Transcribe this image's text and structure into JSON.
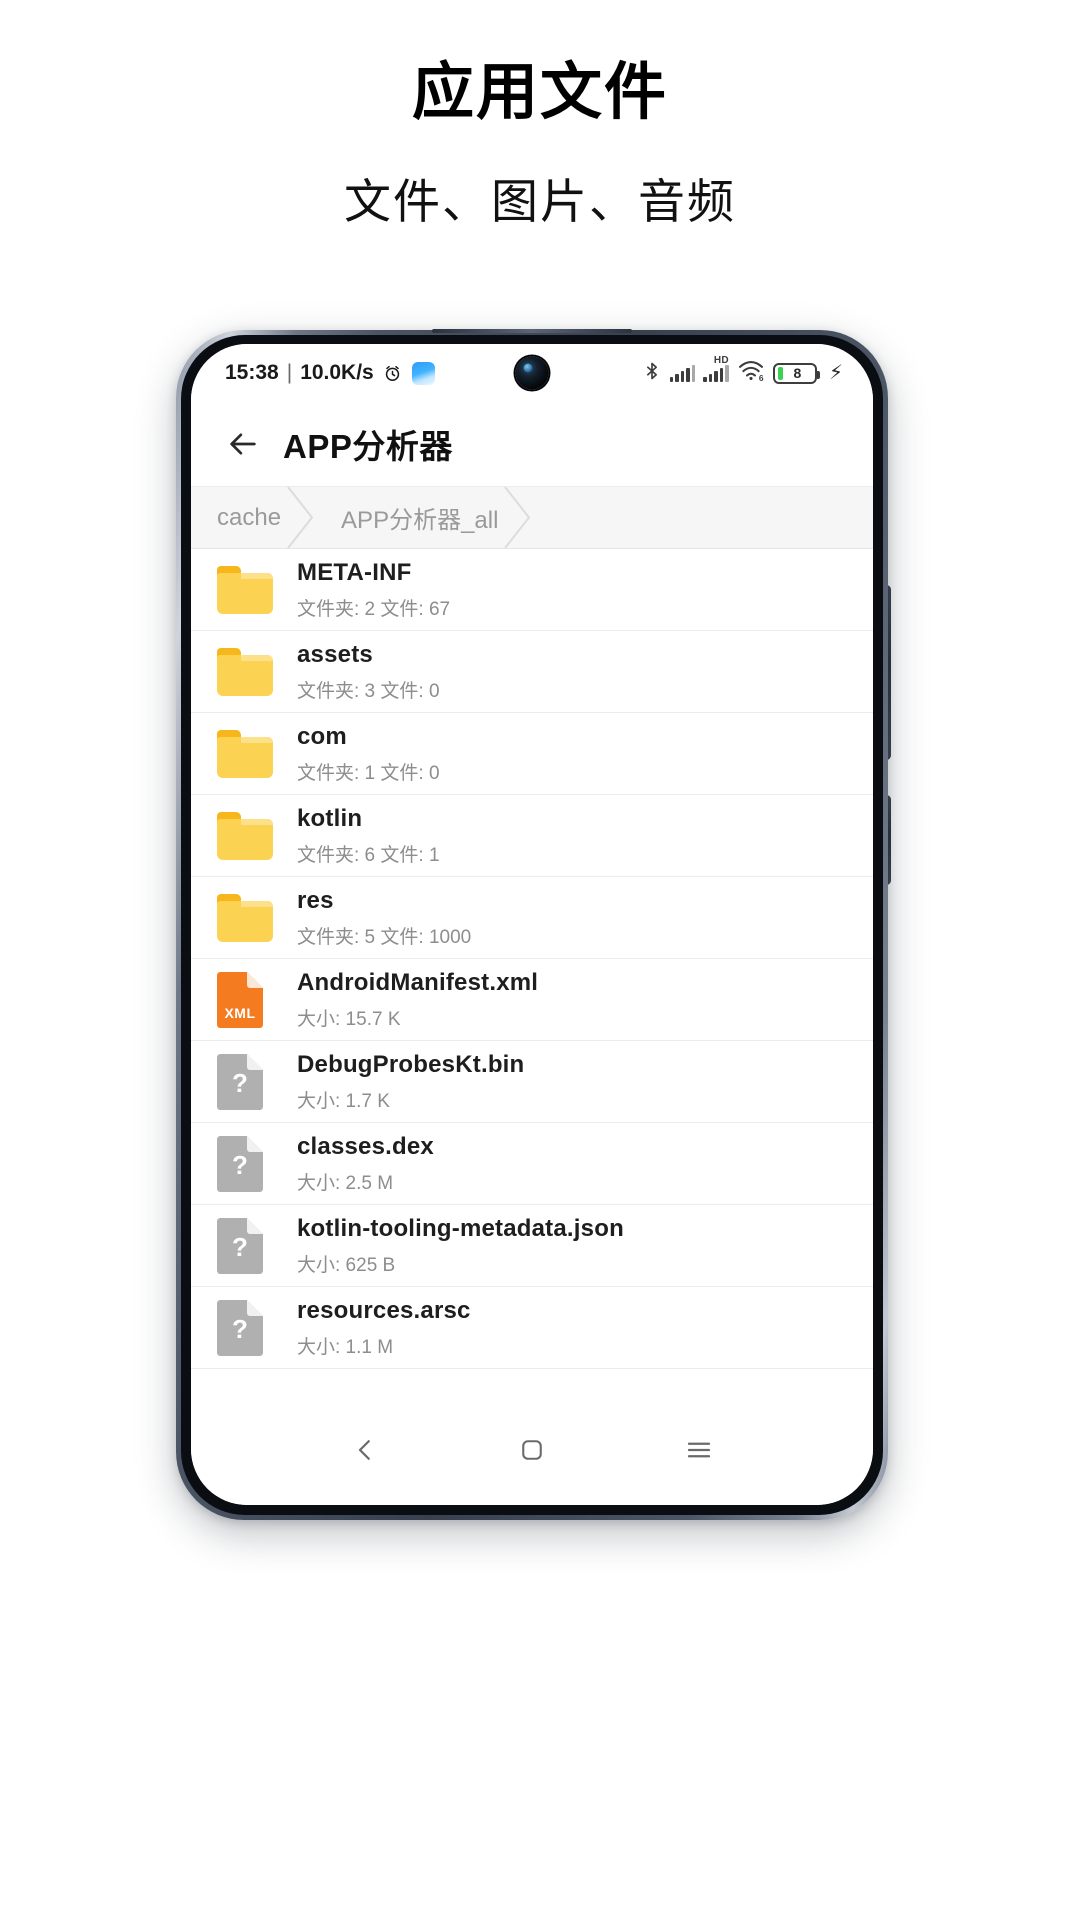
{
  "promo": {
    "title": "应用文件",
    "subtitle": "文件、图片、音频"
  },
  "statusbar": {
    "time": "15:38",
    "divider": "|",
    "netspeed": "10.0K/s",
    "alarm_icon": "alarm-clock-icon",
    "weather_icon": "weather-app-icon",
    "bluetooth_icon": "bluetooth-icon",
    "signal_icon": "signal-bars-icon",
    "hd_label": "HD",
    "wifi_icon": "wifi-6-icon",
    "wifi_label": "6",
    "battery_level": "8",
    "charging_icon": "charging-bolt-icon"
  },
  "appbar": {
    "back_icon": "back-arrow-icon",
    "title": "APP分析器"
  },
  "breadcrumb": {
    "items": [
      {
        "label": "cache"
      },
      {
        "label": "APP分析器_all"
      }
    ]
  },
  "list": {
    "rows": [
      {
        "name": "META-INF",
        "sub": "文件夹: 2 文件: 67",
        "icon": "folder-icon",
        "kind": "folder"
      },
      {
        "name": "assets",
        "sub": "文件夹: 3 文件: 0",
        "icon": "folder-icon",
        "kind": "folder"
      },
      {
        "name": "com",
        "sub": "文件夹: 1 文件: 0",
        "icon": "folder-icon",
        "kind": "folder"
      },
      {
        "name": "kotlin",
        "sub": "文件夹: 6 文件: 1",
        "icon": "folder-icon",
        "kind": "folder"
      },
      {
        "name": "res",
        "sub": "文件夹: 5 文件: 1000",
        "icon": "folder-icon",
        "kind": "folder"
      },
      {
        "name": "AndroidManifest.xml",
        "sub": "大小: 15.7 K",
        "icon": "xml-file-icon",
        "kind": "xml",
        "badge": "XML"
      },
      {
        "name": "DebugProbesKt.bin",
        "sub": "大小: 1.7 K",
        "icon": "unknown-file-icon",
        "kind": "unknown",
        "badge": "?"
      },
      {
        "name": "classes.dex",
        "sub": "大小: 2.5 M",
        "icon": "unknown-file-icon",
        "kind": "unknown",
        "badge": "?"
      },
      {
        "name": "kotlin-tooling-metadata.json",
        "sub": "大小: 625 B",
        "icon": "unknown-file-icon",
        "kind": "unknown",
        "badge": "?"
      },
      {
        "name": "resources.arsc",
        "sub": "大小: 1.1 M",
        "icon": "unknown-file-icon",
        "kind": "unknown",
        "badge": "?"
      }
    ]
  },
  "navbar": {
    "back_icon": "nav-back-icon",
    "home_icon": "nav-home-icon",
    "recents_icon": "nav-menu-icon"
  },
  "colors": {
    "folder": "#fcd253",
    "folder_tab": "#f6b61c",
    "xml": "#f47b20",
    "unknown": "#b0b0b0",
    "battery_green": "#39d353",
    "text_primary": "#1e1e1e",
    "text_secondary": "#8d8d8d"
  }
}
